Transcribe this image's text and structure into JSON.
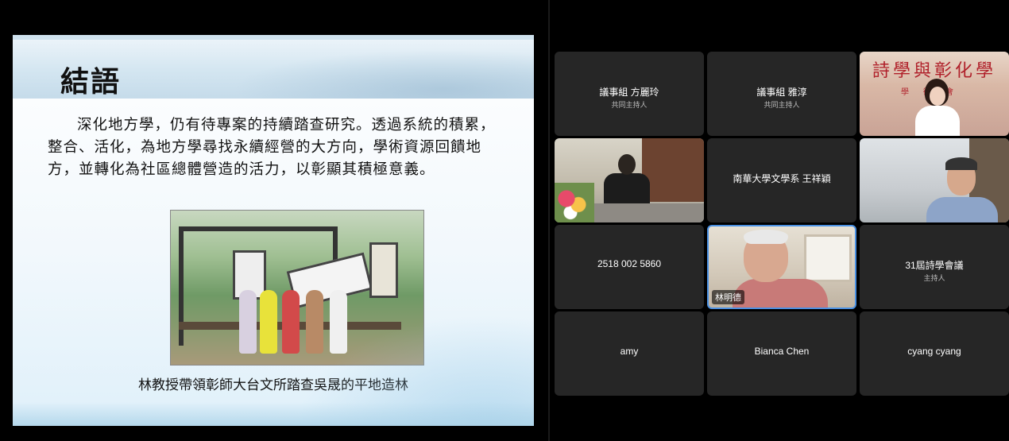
{
  "slide": {
    "title": "結語",
    "body": "深化地方學，仍有待專案的持續踏查研究。透過系統的積累，整合、活化，為地方學尋找永續經營的大方向，學術資源回饋地方，並轉化為社區總體營造的活力，以彰顯其積極意義。",
    "photo_caption": "林教授帶領彰師大台文所踏查吳晟的平地造林"
  },
  "colors": {
    "tile_bg": "#262626",
    "active_border": "#4a90e2",
    "poetry_red": "#b0202a"
  },
  "gallery": {
    "tiles": [
      {
        "name": "議事組 方麗玲",
        "role": "共同主持人",
        "type": "text"
      },
      {
        "name": "議事組 雅淳",
        "role": "共同主持人",
        "type": "text"
      },
      {
        "name": "",
        "role": "",
        "type": "video",
        "banner": "詩學與彰化學",
        "sub": "學術會"
      },
      {
        "name": "",
        "role": "",
        "type": "video"
      },
      {
        "name": "南華大學文學系 王祥穎",
        "role": "",
        "type": "text"
      },
      {
        "name": "",
        "role": "",
        "type": "video"
      },
      {
        "name": "2518 002 5860",
        "role": "",
        "type": "text"
      },
      {
        "name": "林明德",
        "role": "",
        "type": "video",
        "active": true
      },
      {
        "name": "31屆詩學會議",
        "role": "主持人",
        "type": "text"
      },
      {
        "name": "amy",
        "role": "",
        "type": "text"
      },
      {
        "name": "Bianca Chen",
        "role": "",
        "type": "text"
      },
      {
        "name": "cyang cyang",
        "role": "",
        "type": "text"
      }
    ]
  }
}
